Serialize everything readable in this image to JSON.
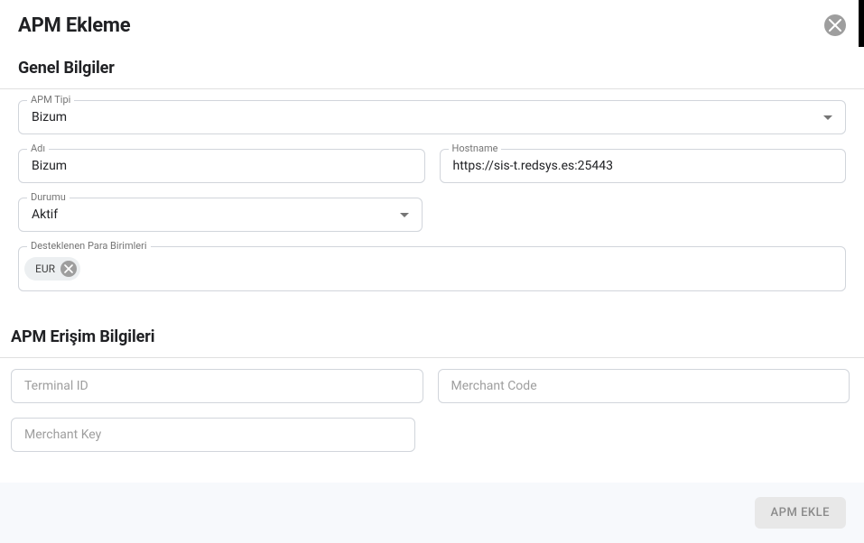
{
  "dialog": {
    "title": "APM Ekleme"
  },
  "sections": {
    "general": "Genel Bilgiler",
    "access": "APM Erişim Bilgileri"
  },
  "fields": {
    "apm_tipi": {
      "label": "APM Tipi",
      "value": "Bizum"
    },
    "adi": {
      "label": "Adı",
      "value": "Bizum"
    },
    "hostname": {
      "label": "Hostname",
      "value": "https://sis-t.redsys.es:25443"
    },
    "durumu": {
      "label": "Durumu",
      "value": "Aktif"
    },
    "currencies": {
      "label": "Desteklenen Para Birimleri",
      "chips": [
        "EUR"
      ]
    },
    "terminal_id": {
      "placeholder": "Terminal ID",
      "value": ""
    },
    "merchant_code": {
      "placeholder": "Merchant Code",
      "value": ""
    },
    "merchant_key": {
      "placeholder": "Merchant Key",
      "value": ""
    }
  },
  "buttons": {
    "submit": "APM EKLE"
  }
}
